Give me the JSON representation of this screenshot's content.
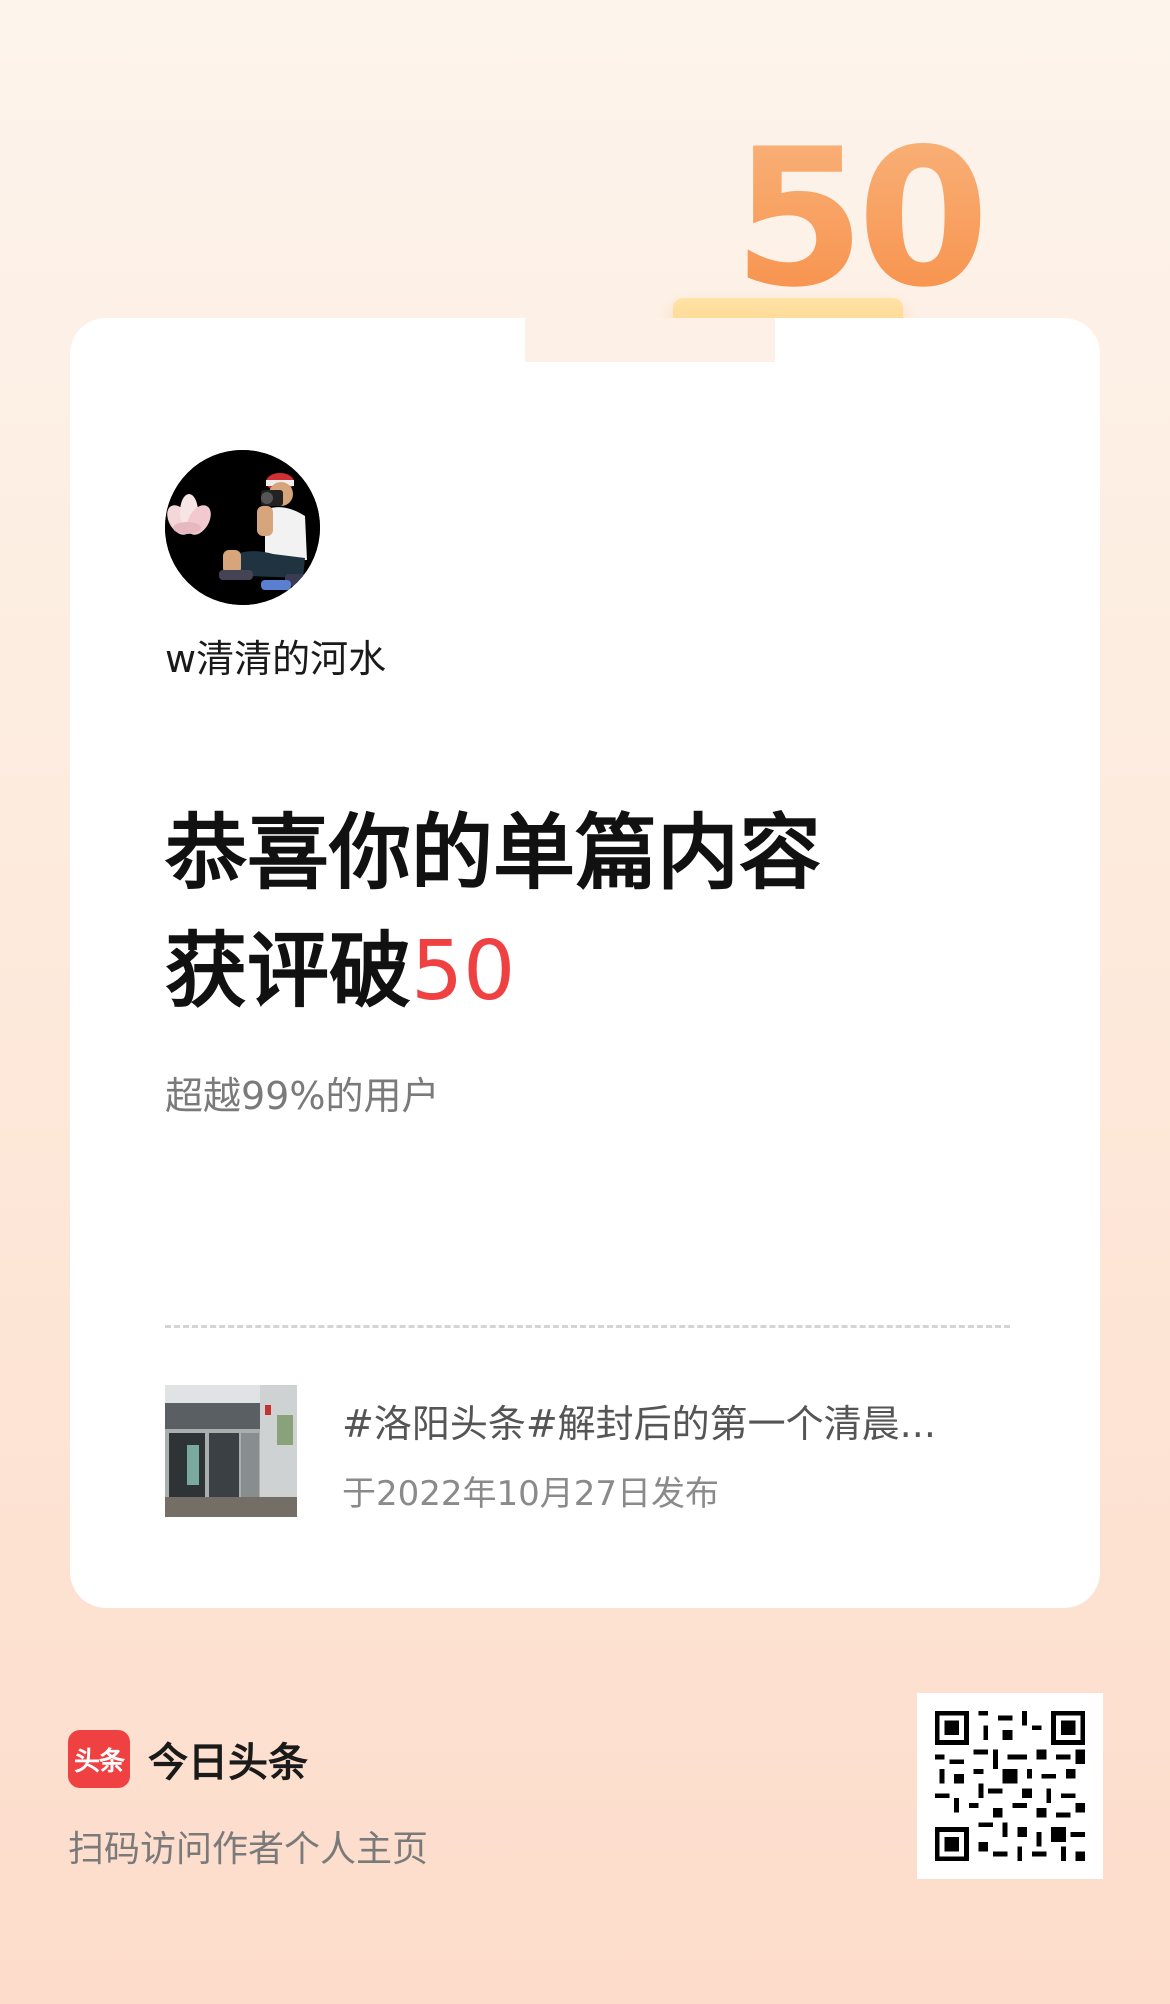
{
  "badge": {
    "number": "50"
  },
  "author": {
    "name": "w清清的河水"
  },
  "headline": {
    "line1": "恭喜你的单篇内容",
    "line2_prefix": "获评破",
    "line2_number": "50"
  },
  "subline": "超越99%的用户",
  "post": {
    "title": "#洛阳头条#解封后的第一个清晨...",
    "date": "于2022年10月27日发布"
  },
  "footer": {
    "logo_text": "头条",
    "brand_name": "今日头条",
    "caption": "扫码访问作者个人主页"
  },
  "colors": {
    "accent": "#f04142",
    "badge_orange": "#f7904a",
    "badge_pink": "#f98e98"
  },
  "icons": [
    "qr-code-icon",
    "toutiao-logo-icon"
  ]
}
